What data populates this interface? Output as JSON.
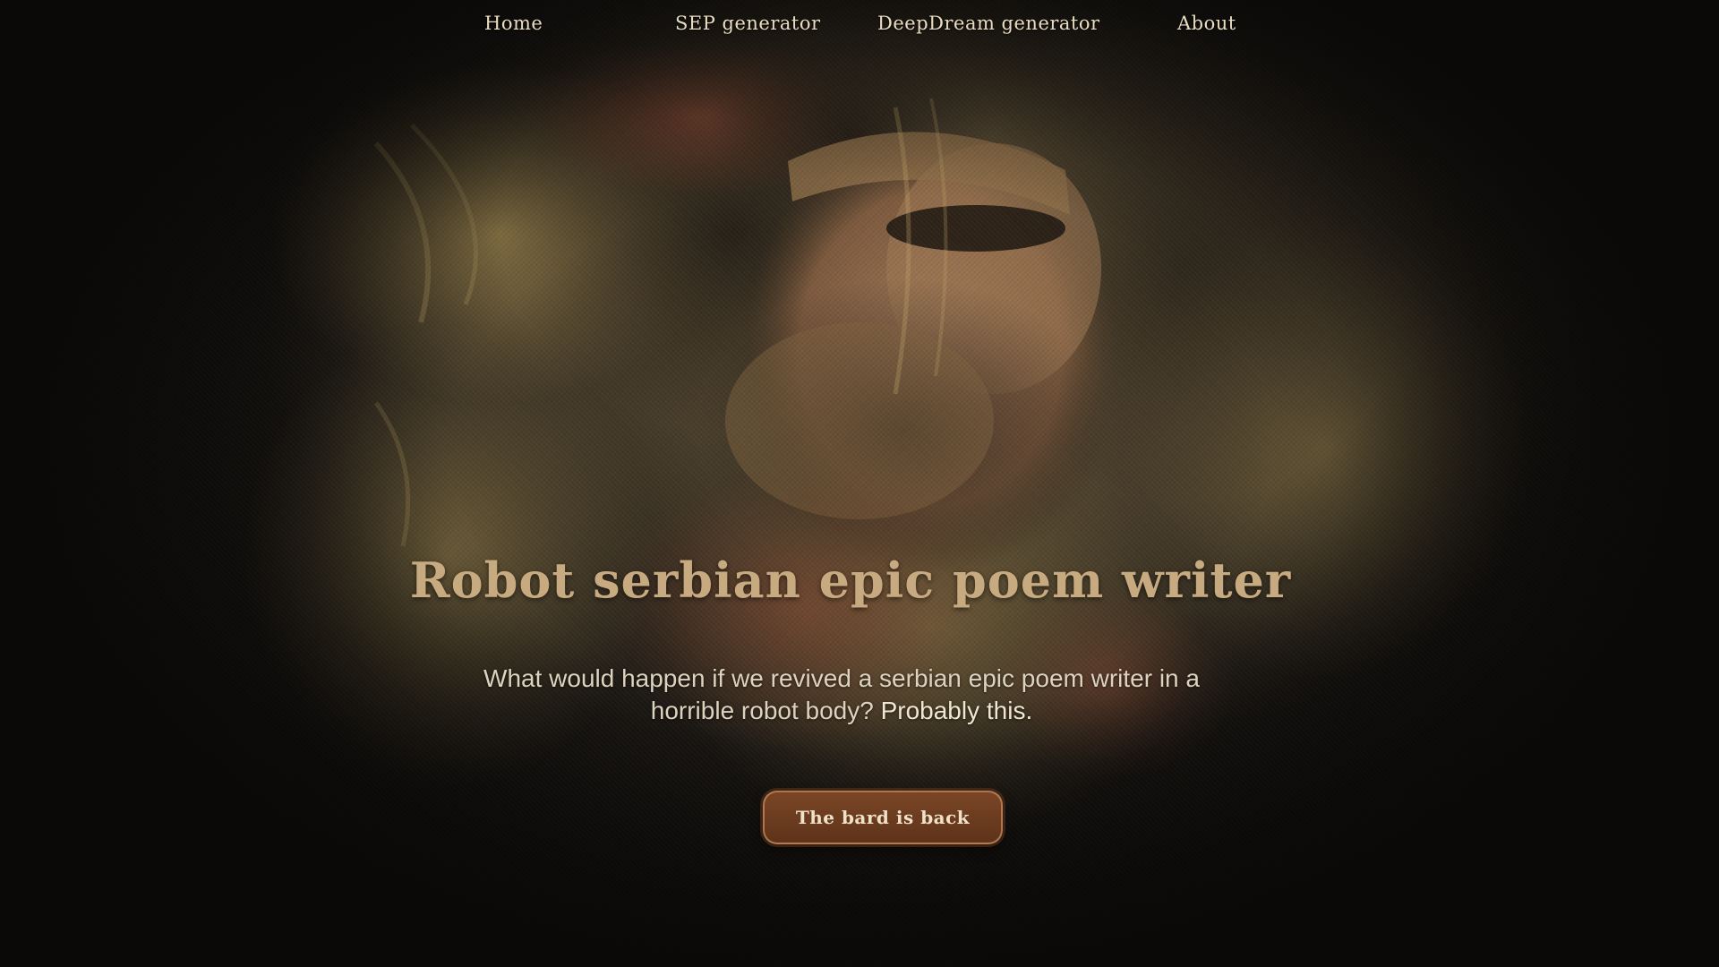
{
  "nav": {
    "home": "Home",
    "sep_generator": "SEP generator",
    "deepdream_generator": "DeepDream generator",
    "about": "About"
  },
  "hero": {
    "title": "Robot serbian epic poem writer",
    "subtitle_main": "What would happen if we revived a serbian epic poem writer in a horrible robot body?",
    "subtitle_emphasis": "Probably this.",
    "cta_label": "The bard is back"
  },
  "colors": {
    "nav_text": "#e9dcc0",
    "title": "#c7aa80",
    "subtitle": "#ddd2bd",
    "button_bg": "#6b3b1f",
    "button_text": "#f0e2c8",
    "background_dark": "#141210"
  }
}
